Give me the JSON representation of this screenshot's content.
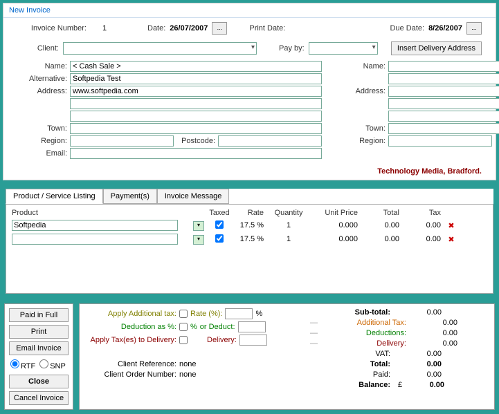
{
  "title": "New Invoice",
  "header": {
    "invoiceNumLbl": "Invoice Number:",
    "invoiceNum": "1",
    "dateLbl": "Date:",
    "date": "26/07/2007",
    "printDateLbl": "Print Date:",
    "dueDateLbl": "Due Date:",
    "dueDate": "8/26/2007",
    "ellipsis": "..."
  },
  "row2": {
    "clientLbl": "Client:",
    "payByLbl": "Pay by:",
    "insertDelivery": "Insert Delivery Address"
  },
  "addr": {
    "nameLbl": "Name:",
    "altLbl": "Alternative:",
    "addrLbl": "Address:",
    "townLbl": "Town:",
    "regionLbl": "Region:",
    "postcodeLbl": "Postcode:",
    "emailLbl": "Email:",
    "left": {
      "name": "< Cash Sale >",
      "alt": "Softpedia Test",
      "addr1": "www.softpedia.com"
    }
  },
  "techNote": "Technology Media, Bradford.",
  "tabs": {
    "t1": "Product / Service Listing",
    "t2": "Payment(s)",
    "t3": "Invoice Message"
  },
  "cols": {
    "product": "Product",
    "taxed": "Taxed",
    "rate": "Rate",
    "qty": "Quantity",
    "unitPrice": "Unit Price",
    "total": "Total",
    "tax": "Tax"
  },
  "rows": [
    {
      "product": "Softpedia",
      "taxed": true,
      "rate": "17.5",
      "pct": "%",
      "qty": "1",
      "unitPrice": "0.000",
      "total": "0.00",
      "tax": "0.00"
    },
    {
      "product": "",
      "taxed": true,
      "rate": "17.5",
      "pct": "%",
      "qty": "1",
      "unitPrice": "0.000",
      "total": "0.00",
      "tax": "0.00"
    }
  ],
  "sideBtns": {
    "paidFull": "Paid in Full",
    "print": "Print",
    "email": "Email Invoice",
    "rtf": "RTF",
    "snp": "SNP",
    "close": "Close",
    "cancel": "Cancel Invoice"
  },
  "totals": {
    "applyAddTax": "Apply Additional tax:",
    "ratePct": "Rate (%):",
    "deductPct": "Deduction as %:",
    "orDeduct": "or Deduct:",
    "applyTaxDelivery": "Apply Tax(es) to Delivery:",
    "delivery": "Delivery:",
    "clientRef": "Client Reference:",
    "clientOrder": "Client Order Number:",
    "none": "none",
    "pct": "%",
    "subTotal": "Sub-total:",
    "addTax": "Additional Tax:",
    "deductions": "Deductions:",
    "deliveryR": "Delivery:",
    "vat": "VAT:",
    "total": "Total:",
    "paid": "Paid:",
    "balance": "Balance:",
    "currency": "£",
    "v000": "0.00"
  }
}
